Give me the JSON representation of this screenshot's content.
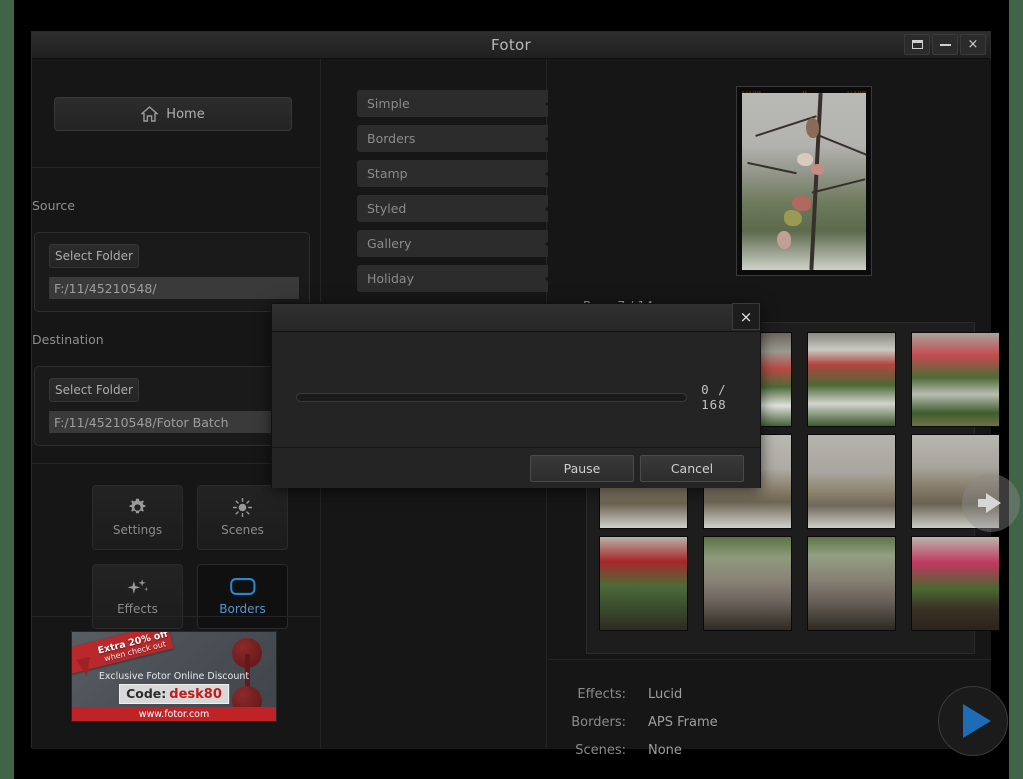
{
  "window": {
    "title": "Fotor",
    "controls": [
      {
        "name": "restore-button",
        "label": "restore-icon"
      },
      {
        "name": "minimize-button",
        "label": "minimize-icon"
      },
      {
        "name": "close-button",
        "label": "×"
      }
    ]
  },
  "sidebar": {
    "home_label": "Home",
    "source": {
      "section_label": "Source",
      "select_folder_label": "Select Folder",
      "path": "F:/11/45210548/"
    },
    "destination": {
      "section_label": "Destination",
      "select_folder_label": "Select Folder",
      "path": "F:/11/45210548/Fotor Batch"
    },
    "tools": [
      {
        "label": "Settings",
        "icon": "gear-icon",
        "active": false
      },
      {
        "label": "Scenes",
        "icon": "sun-icon",
        "active": false
      },
      {
        "label": "Effects",
        "icon": "sparkles-icon",
        "active": false
      },
      {
        "label": "Borders",
        "icon": "rounded-rect-icon",
        "active": true
      }
    ],
    "ad": {
      "ribbon_main": "Extra 20% off",
      "ribbon_sub": "when check out",
      "headline": "Exclusive Fotor Online Discount",
      "code_label": "Code:",
      "code_value": "desk80",
      "url": "www.fotor.com"
    }
  },
  "categories": [
    {
      "label": "Simple"
    },
    {
      "label": "Borders"
    },
    {
      "label": "Stamp"
    },
    {
      "label": "Styled"
    },
    {
      "label": "Gallery"
    },
    {
      "label": "Holiday"
    }
  ],
  "preview": {
    "film_left": "2 = 0.1500",
    "film_mid": "-65",
    "film_right": "1 = 0.1500"
  },
  "browser": {
    "page_label": "Page  7  /  14",
    "next_page_label": "next-page-arrow",
    "thumbnails": [
      {
        "alt": "snow-tulips-1"
      },
      {
        "alt": "red-tulips-snow"
      },
      {
        "alt": "snow-garden-tulips"
      },
      {
        "alt": "red-tulips-wall"
      },
      {
        "alt": "snowy-field-1"
      },
      {
        "alt": "snowy-field-2"
      },
      {
        "alt": "snowy-landscape"
      },
      {
        "alt": "snowy-post-field"
      },
      {
        "alt": "red-tulip-closeup"
      },
      {
        "alt": "cat-in-garden-1"
      },
      {
        "alt": "cat-in-garden-2"
      },
      {
        "alt": "pink-tulip-closeup"
      }
    ]
  },
  "info": {
    "rows": [
      {
        "key": "Effects:",
        "value": "Lucid"
      },
      {
        "key": "Borders:",
        "value": "APS Frame"
      },
      {
        "key": "Scenes:",
        "value": "None"
      }
    ],
    "play_label": "play-icon"
  },
  "modal": {
    "title": "",
    "close_label": "×",
    "progress_value": 0,
    "progress_total": 168,
    "progress_text": "0  /  168",
    "buttons": [
      {
        "label": "Pause",
        "name": "pause-button"
      },
      {
        "label": "Cancel",
        "name": "cancel-button"
      }
    ]
  },
  "colors": {
    "accent_blue": "#1d6cb5",
    "active_label": "#5a93c9",
    "ad_red": "#c02325",
    "desktop_green": "#3f6447"
  }
}
